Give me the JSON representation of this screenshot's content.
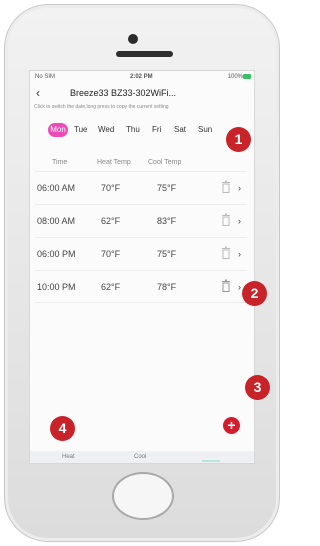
{
  "status_bar": {
    "carrier": "No SIM",
    "time": "2:02 PM",
    "battery": "100%"
  },
  "nav": {
    "back_icon": "chevron-left-icon",
    "title": "Breeze33 BZ33-302WiFi..."
  },
  "hint": "Click to switch the date,long press to copy the current setting",
  "days": {
    "items": [
      "Mon",
      "Tue",
      "Wed",
      "Thu",
      "Fri",
      "Sat",
      "Sun"
    ],
    "selected": "Mon",
    "accent_color": "#ec4bb5"
  },
  "columns": {
    "time": "Time",
    "heat": "Heat Temp",
    "cool": "Cool Temp"
  },
  "rows": [
    {
      "time": "06:00 AM",
      "heat": "70°F",
      "cool": "75°F"
    },
    {
      "time": "08:00 AM",
      "heat": "62°F",
      "cool": "83°F"
    },
    {
      "time": "06:00 PM",
      "heat": "70°F",
      "cool": "75°F"
    },
    {
      "time": "10:00 PM",
      "heat": "62°F",
      "cool": "78°F"
    }
  ],
  "add_button": {
    "label": "+",
    "color": "#d41d2c"
  },
  "tabs": {
    "heat": "Heat",
    "cool": "Cool"
  },
  "callouts": [
    "1",
    "2",
    "3",
    "4"
  ],
  "callout_color": "#c72329"
}
